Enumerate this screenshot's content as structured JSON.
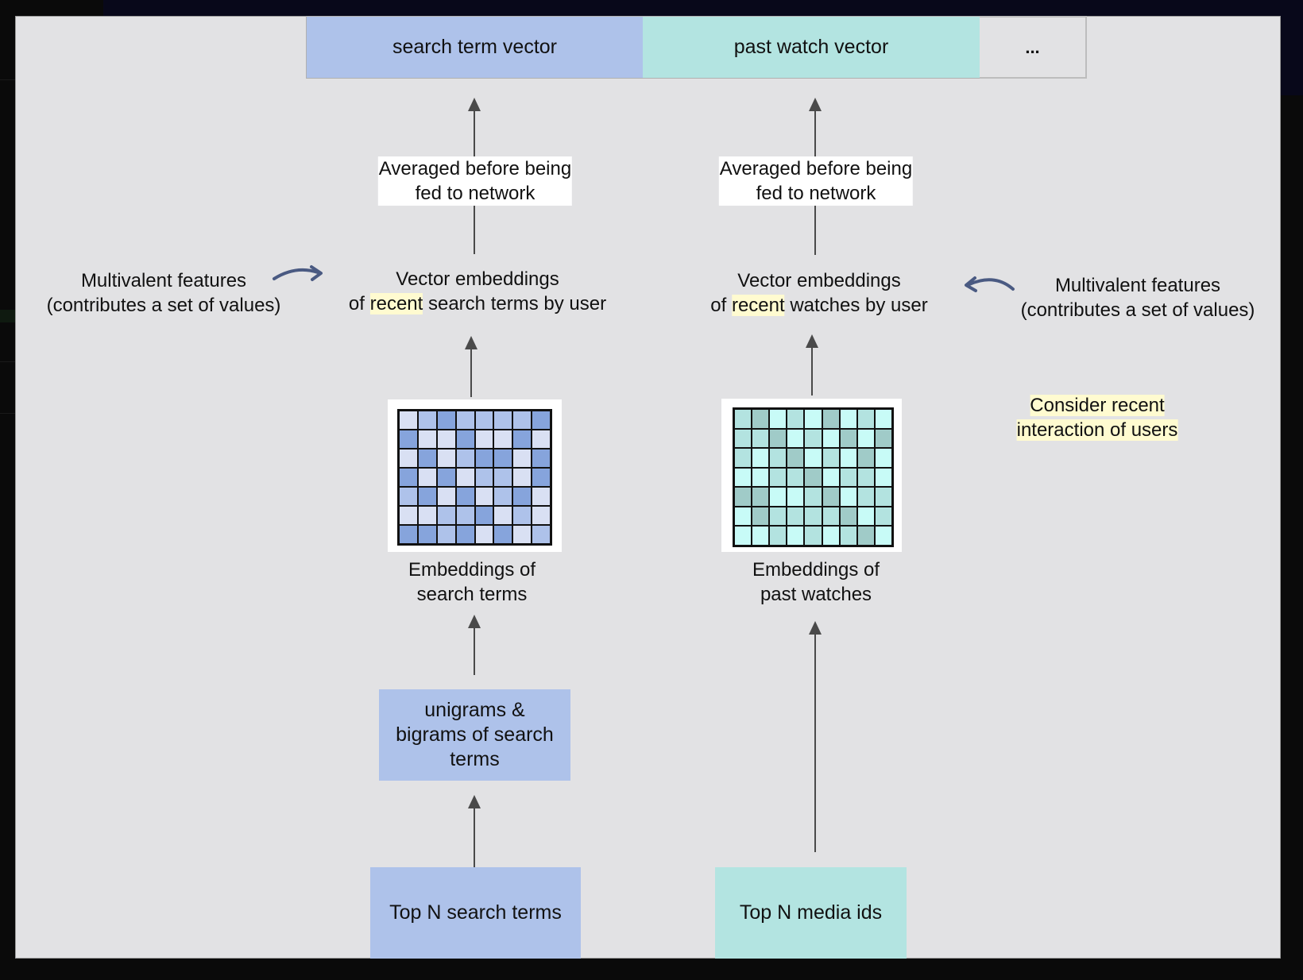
{
  "vector_bar": {
    "segments": [
      {
        "label": "search term vector",
        "color": "#aec2ea"
      },
      {
        "label": "past watch vector",
        "color": "#b3e4e1"
      },
      {
        "label": "...",
        "color": "#e2e2e4"
      }
    ]
  },
  "left_column": {
    "averaged_label": [
      "Averaged before being",
      "fed to network"
    ],
    "vector_embeddings": {
      "line1": "Vector embeddings",
      "line2_prefix": "of ",
      "highlight": "recent",
      "line2_suffix": " search terms by user"
    },
    "embeddings_label": [
      "Embeddings of",
      "search terms"
    ],
    "ngram_box": [
      "unigrams &",
      "bigrams of search",
      "terms"
    ],
    "source_box": "Top N search terms",
    "grid": {
      "shades": {
        "L": "#d9e0f3",
        "M": "#aec2ea",
        "D": "#86a4dc"
      },
      "rows": [
        "LMDMMMMD",
        "DLLDLLDL",
        "LDLMDDLD",
        "DLDLMMLD",
        "MDLDLMDL",
        "LLMMDLML",
        "DDMDLDLM"
      ]
    }
  },
  "right_column": {
    "averaged_label": [
      "Averaged before being",
      "fed to network"
    ],
    "vector_embeddings": {
      "line1": "Vector embeddings",
      "line2_prefix": "of ",
      "highlight": "recent",
      "line2_suffix": " watches by user"
    },
    "embeddings_label": [
      "Embeddings of",
      "past watches"
    ],
    "source_box": "Top N media ids",
    "grid": {
      "shades": {
        "L": "#c8fbf7",
        "M": "#b3e3e0",
        "D": "#a0cbc8"
      },
      "rows": [
        "MDLMLDLML",
        "MMDLMLDLD",
        "MLMDLMLDL",
        "LLMMDLMML",
        "DDLLMDLMM",
        "LDMMMMDLM",
        "LLMLMLMDL"
      ]
    }
  },
  "annotations": {
    "multivalent_left": [
      "Multivalent features",
      "(contributes a set of values)"
    ],
    "multivalent_right": [
      "Multivalent features",
      "(contributes a set of values)"
    ],
    "recent_note": [
      "Consider recent",
      "interaction of users"
    ]
  },
  "colors": {
    "arrow": "#4a4a4a",
    "curved_arrow": "#4a5a82",
    "highlight": "#fffbd0",
    "panel_bg": "#e2e2e4"
  }
}
